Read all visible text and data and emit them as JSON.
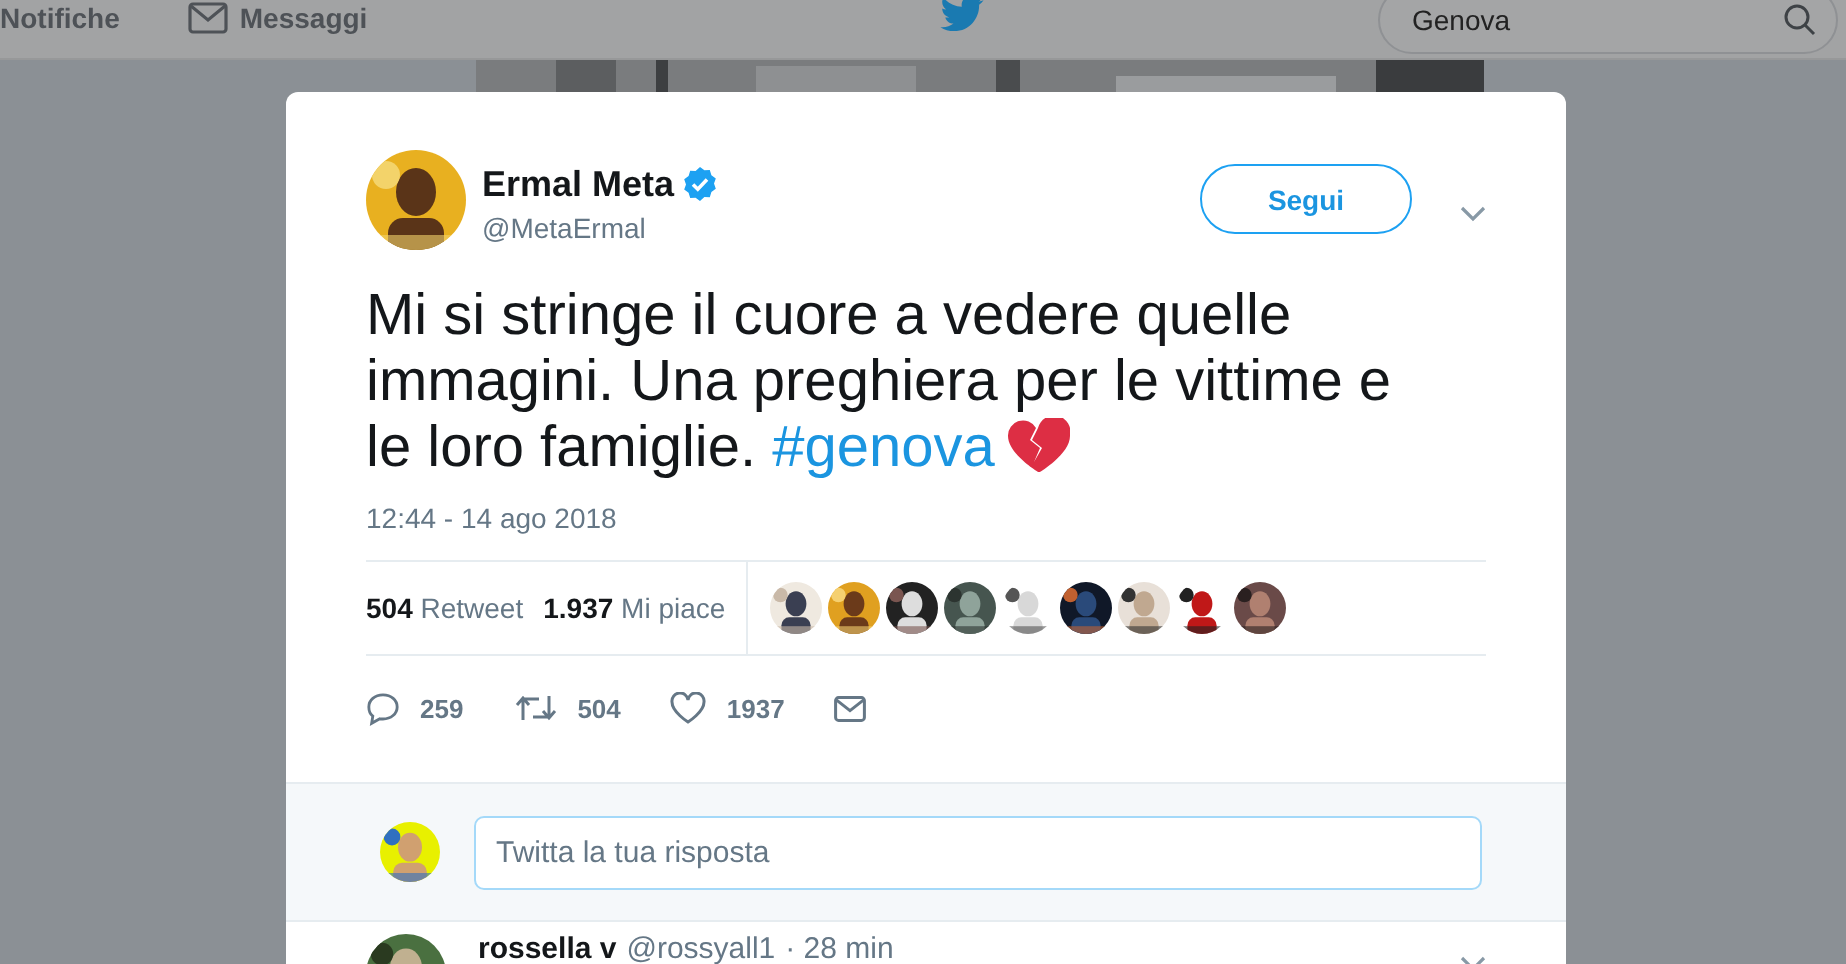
{
  "topbar": {
    "nav": [
      {
        "kind": "plain",
        "label": "Notifiche"
      },
      {
        "kind": "mail",
        "label": "Messaggi"
      }
    ],
    "search": {
      "value": "Genova"
    }
  },
  "tweet": {
    "author": {
      "name": "Ermal Meta",
      "handle": "@MetaErmal",
      "verified": true
    },
    "follow_button": "Segui",
    "text": "Mi si stringe il cuore a vedere quelle immagini. Una preghiera per le vittime e le loro famiglie.",
    "hashtag": "#genova",
    "timestamp": "12:44 - 14 ago 2018",
    "stats": [
      {
        "count": "504",
        "label": "Retweet"
      },
      {
        "count": "1.937",
        "label": "Mi piace"
      }
    ],
    "actions": [
      {
        "kind": "reply",
        "count": "259"
      },
      {
        "kind": "retweet",
        "count": "504"
      },
      {
        "kind": "like",
        "count": "1937"
      },
      {
        "kind": "message"
      }
    ]
  },
  "reply_box": {
    "placeholder": "Twitta la tua risposta"
  },
  "next_reply": {
    "name": "rossella v",
    "handle": "@rossyall1",
    "time": "· 28 min"
  }
}
